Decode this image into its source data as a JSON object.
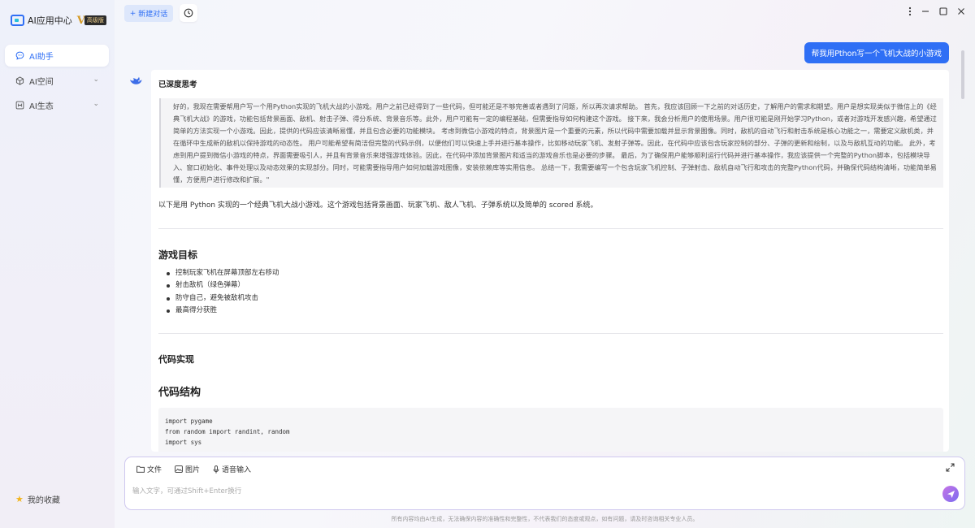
{
  "sidebar": {
    "brand_name": "AI应用中心",
    "brand_badge": "高级版",
    "items": [
      {
        "label": "AI助手"
      },
      {
        "label": "AI空间"
      },
      {
        "label": "AI生态"
      }
    ],
    "favorites_label": "我的收藏"
  },
  "toolbar": {
    "new_chat_label": "新建对话"
  },
  "chat": {
    "user_message": "帮我用Pthon写一个飞机大战的小游戏",
    "think_title": "已深度思考",
    "think_text": "好的，我现在需要帮用户写一个用Python实现的飞机大战的小游戏。用户之前已经得到了一些代码，但可能还是不够完善或者遇到了问题，所以再次请求帮助。 首先，我应该回顾一下之前的对话历史，了解用户的需求和期望。用户是想实现类似于微信上的《经典飞机大战》的游戏，功能包括背景画面、敌机、射击子弹、得分系统、背景音乐等。此外，用户可能有一定的编程基础，但需要指导如何构建这个游戏。 接下来，我会分析用户的使用场景。用户很可能是刚开始学习Python，或者对游戏开发感兴趣，希望通过简单的方法实现一个小游戏。因此，提供的代码应该清晰易懂，并且包含必要的功能模块。 考虑到微信小游戏的特点，背景图片是一个重要的元素，所以代码中需要加载并显示背景图像。同时，敌机的自动飞行和射击系统是核心功能之一，需要定义敌机类，并在循环中生成新的敌机以保持游戏的动态性。 用户可能希望有简洁但完整的代码示例，以便他们可以快速上手并进行基本操作，比如移动玩家飞机、发射子弹等。因此，在代码中应该包含玩家控制的部分、子弹的更新和绘制，以及与敌机互动的功能。 此外，考虑到用户提到微信小游戏的特点，界面需要吸引人，并且有背景音乐来增强游戏体验。因此，在代码中添加背景图片和适当的游戏音乐也是必要的步骤。 最后，为了确保用户能够顺利运行代码并进行基本操作，我应该提供一个完整的Python脚本，包括模块导入、窗口初始化、事件处理以及动态效果的实现部分。同时，可能需要指导用户如何加载游戏图像，安装依赖库等实用信息。 总结一下，我需要编写一个包含玩家飞机控制、子弹射击、敌机自动飞行和攻击的完整Python代码，并确保代码结构清晰，功能简单易懂，方便用户进行修改和扩展。\"",
    "intro": "以下是用 Python 实现的一个经典飞机大战小游戏。这个游戏包括背景画面、玩家飞机、敌人飞机、子弹系统以及简单的 scored 系统。",
    "goal_heading": "游戏目标",
    "goals": [
      "控制玩家飞机在屏幕顶部左右移动",
      "射击敌机（绿色弹幕）",
      "防守自己，避免被敌机攻击",
      "最高得分获胜"
    ],
    "impl_heading": "代码实现",
    "struct_heading": "代码结构",
    "code_lines": [
      "import pygame",
      "from random import randint, random",
      "import sys"
    ]
  },
  "input": {
    "tools": [
      {
        "label": "文件"
      },
      {
        "label": "图片"
      },
      {
        "label": "语音输入"
      }
    ],
    "placeholder": "输入文字，可通过Shift+Enter换行"
  },
  "footer": "所有内容均由AI生成，无法确保内容的准确性和完整性，不代表我们的态度或观点，如有问题，请及时咨询相关专业人员。",
  "colors": {
    "accent": "#2f6ff5",
    "send_gradient_start": "#c774e6",
    "send_gradient_end": "#7b6cf0"
  }
}
